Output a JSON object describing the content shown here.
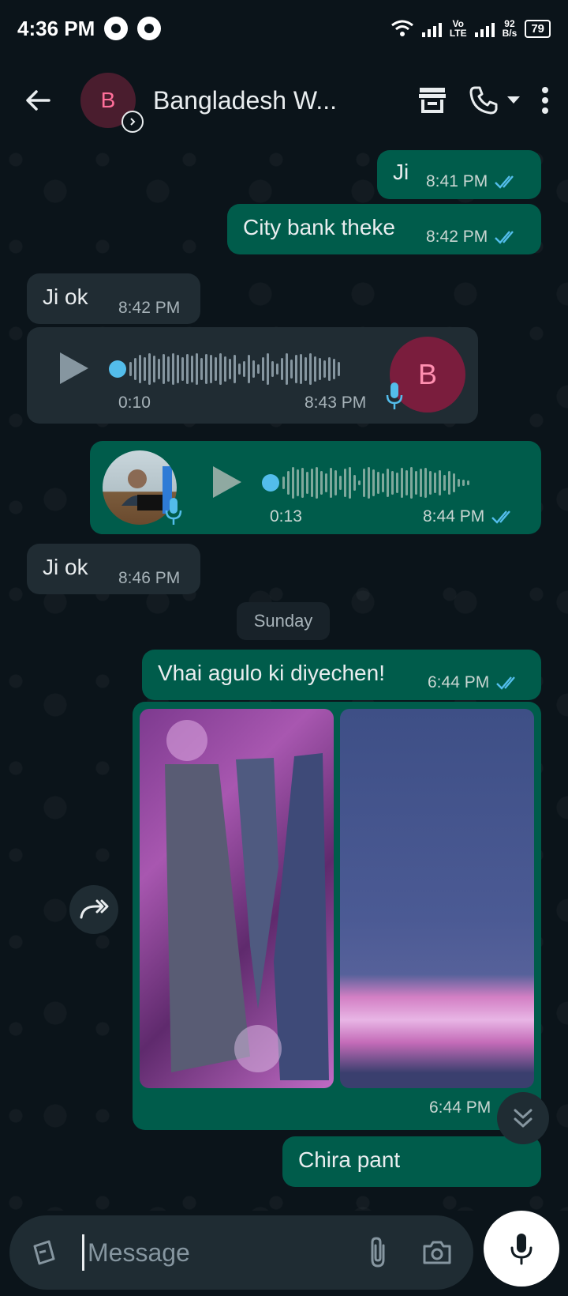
{
  "status_bar": {
    "time": "4:36 PM",
    "network_type_top": "Vo",
    "network_type_bottom": "LTE",
    "speed_value": "92",
    "speed_unit": "B/s",
    "battery": "79"
  },
  "header": {
    "avatar_letter": "B",
    "contact_name": "Bangladesh W..."
  },
  "messages": {
    "m1": {
      "text": "Ji",
      "time": "8:41 PM"
    },
    "m2": {
      "text": "City bank theke",
      "time": "8:42 PM"
    },
    "m3": {
      "text": "Ji ok",
      "time": "8:42 PM"
    },
    "voice_in": {
      "duration": "0:10",
      "time": "8:43 PM",
      "avatar_letter": "B"
    },
    "voice_out": {
      "duration": "0:13",
      "time": "8:44 PM"
    },
    "m4": {
      "text": "Ji ok",
      "time": "8:46 PM"
    },
    "date_divider": "Sunday",
    "m5": {
      "text": "Vhai agulo ki diyechen!",
      "time": "6:44 PM"
    },
    "images": {
      "time": "6:44 PM"
    },
    "m6": {
      "text": "Chira pant"
    }
  },
  "composer": {
    "placeholder": "Message"
  },
  "colors": {
    "outgoing_bubble": "#005c4b",
    "incoming_bubble": "#202c33",
    "read_ticks": "#53bdeb",
    "background": "#0b141a"
  },
  "icons": [
    "back-arrow-icon",
    "shop-icon",
    "phone-icon",
    "dropdown-icon",
    "more-vert-icon",
    "play-icon",
    "mic-icon",
    "forward-icon",
    "scroll-down-icon",
    "sticker-icon",
    "attach-icon",
    "camera-icon"
  ]
}
